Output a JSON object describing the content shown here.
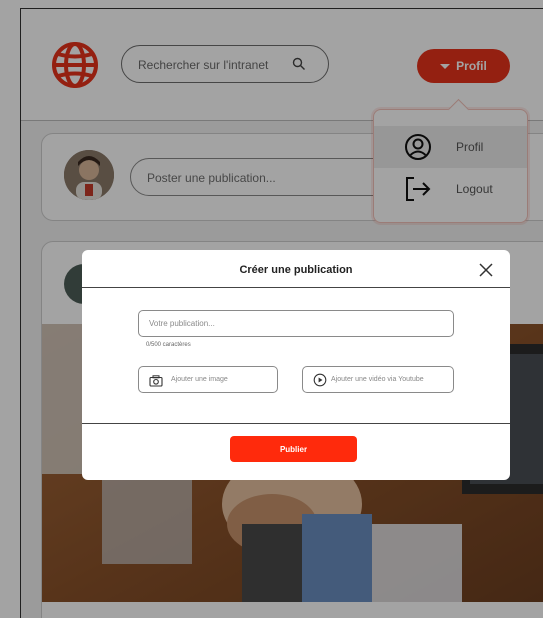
{
  "colors": {
    "accent": "#e8331c",
    "publish": "#ff2a0c"
  },
  "header": {
    "search": {
      "placeholder": "Rechercher sur l'intranet",
      "icon": "search-icon"
    },
    "profile_button": {
      "label": "Profil",
      "icon": "caret-down-icon"
    }
  },
  "profile_menu": {
    "items": [
      {
        "label": "Profil",
        "icon": "user-circle-icon",
        "active": true
      },
      {
        "label": "Logout",
        "icon": "logout-icon",
        "active": false
      }
    ]
  },
  "composer": {
    "placeholder": "Poster une publication..."
  },
  "modal": {
    "title": "Créer une publication",
    "text_placeholder": "Votre publication...",
    "char_counter": "0/500 caractères",
    "add_image_label": "Ajouter une image",
    "add_video_label": "Ajouter une vidéo via Youtube",
    "publish_label": "Publier"
  }
}
